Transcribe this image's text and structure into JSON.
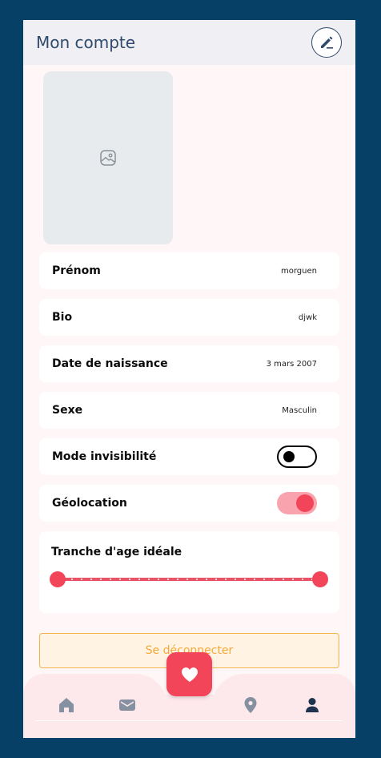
{
  "header": {
    "title": "Mon compte"
  },
  "profile": {
    "rows": [
      {
        "label": "Prénom",
        "value": "morguen"
      },
      {
        "label": "Bio",
        "value": "djwk"
      },
      {
        "label": "Date de naissance",
        "value": "3 mars 2007"
      },
      {
        "label": "Sexe",
        "value": "Masculin"
      }
    ],
    "toggles": [
      {
        "label": "Mode invisibilité",
        "on": false
      },
      {
        "label": "Géolocation",
        "on": true
      }
    ],
    "age_range": {
      "label": "Tranche d'age idéale",
      "min_fraction": 0.0,
      "max_fraction": 1.0
    }
  },
  "logout_label": "Se déconnecter",
  "colors": {
    "accent": "#f3455a",
    "header_text": "#2f4a6b",
    "logout": "#f5a93a",
    "background": "#064066"
  },
  "nav": {
    "items": [
      "home-icon",
      "mail-icon",
      "heart-icon",
      "location-pin-icon",
      "user-icon"
    ],
    "active": "user-icon"
  }
}
